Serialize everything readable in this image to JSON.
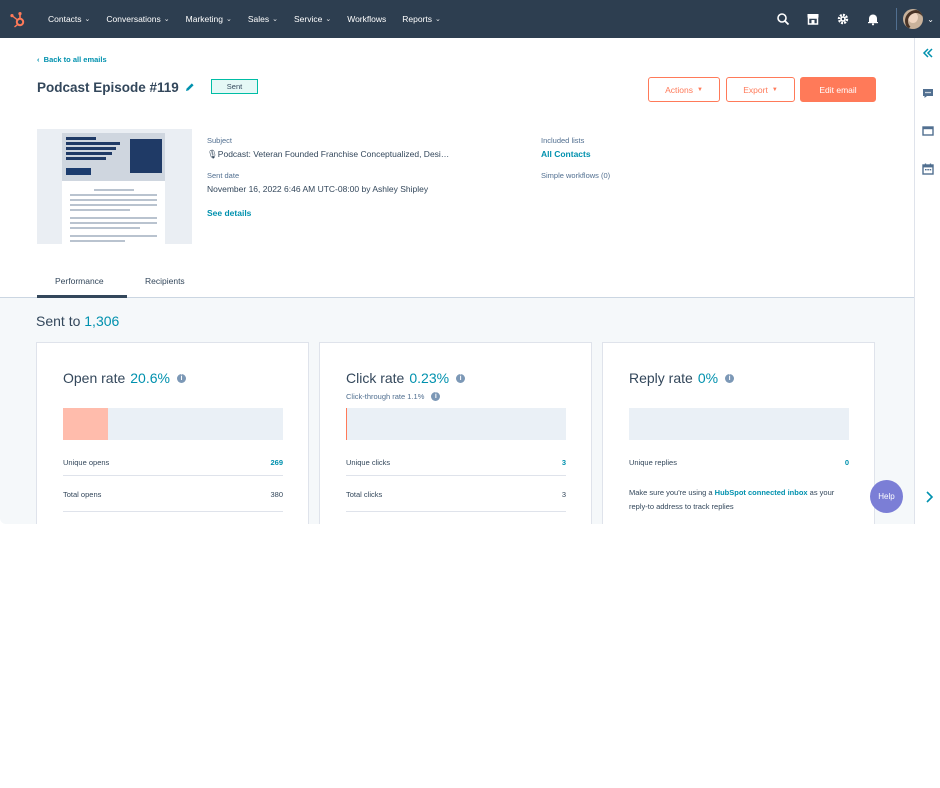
{
  "nav": {
    "links": [
      {
        "label": "Contacts",
        "has_menu": true
      },
      {
        "label": "Conversations",
        "has_menu": true
      },
      {
        "label": "Marketing",
        "has_menu": true
      },
      {
        "label": "Sales",
        "has_menu": true
      },
      {
        "label": "Service",
        "has_menu": true
      },
      {
        "label": "Workflows",
        "has_menu": false
      },
      {
        "label": "Reports",
        "has_menu": true
      }
    ],
    "icons": [
      "search-icon",
      "marketplace-icon",
      "settings-icon",
      "notifications-icon"
    ],
    "chevron": "⌄"
  },
  "header": {
    "back_label": "Back to all emails",
    "back_arrow": "‹",
    "title": "Podcast Episode #119",
    "status": "Sent",
    "actions_label": "Actions",
    "export_label": "Export",
    "edit_label": "Edit email",
    "caret": "▼"
  },
  "summary": {
    "subject_label": "Subject",
    "subject_value": "🎙Podcast: Veteran Founded Franchise Conceptualized, Desi…",
    "sent_date_label": "Sent date",
    "sent_date_value": "November 16, 2022 6:46 AM UTC-08:00 by Ashley Shipley",
    "see_details": "See details",
    "included_lists_label": "Included lists",
    "included_lists_value": "All Contacts",
    "workflows_label": "Simple workflows (0)"
  },
  "tabs": [
    {
      "label": "Performance",
      "active": true
    },
    {
      "label": "Recipients",
      "active": false
    }
  ],
  "performance": {
    "sent_to_label": "Sent to",
    "sent_to_value": "1,306",
    "info_glyph": "i",
    "cards": [
      {
        "title": "Open rate",
        "rate": "20.6%",
        "fill_fraction": 0.206,
        "rows": [
          {
            "label": "Unique opens",
            "value": "269",
            "link": true
          },
          {
            "label": "Total opens",
            "value": "380",
            "link": false
          }
        ]
      },
      {
        "title": "Click rate",
        "rate": "0.23%",
        "subtitle": "Click-through rate 1.1%",
        "fill_fraction": 0.0023,
        "rows": [
          {
            "label": "Unique clicks",
            "value": "3",
            "link": true
          },
          {
            "label": "Total clicks",
            "value": "3",
            "link": false
          }
        ]
      },
      {
        "title": "Reply rate",
        "rate": "0%",
        "fill_fraction": 0,
        "rows": [
          {
            "label": "Unique replies",
            "value": "0",
            "link": true
          }
        ],
        "note_prefix": "Make sure you're using a ",
        "note_link": "HubSpot connected inbox",
        "note_suffix": " as your reply-to address to track replies"
      }
    ]
  },
  "help_label": "Help",
  "colors": {
    "nav_bg": "#2d3e50",
    "accent_orange": "#ff7a59",
    "link_teal": "#0091ae",
    "sent_badge": "#00bda5",
    "meter_fill": "#ffbcac",
    "help_bg": "#7b7ed6"
  }
}
